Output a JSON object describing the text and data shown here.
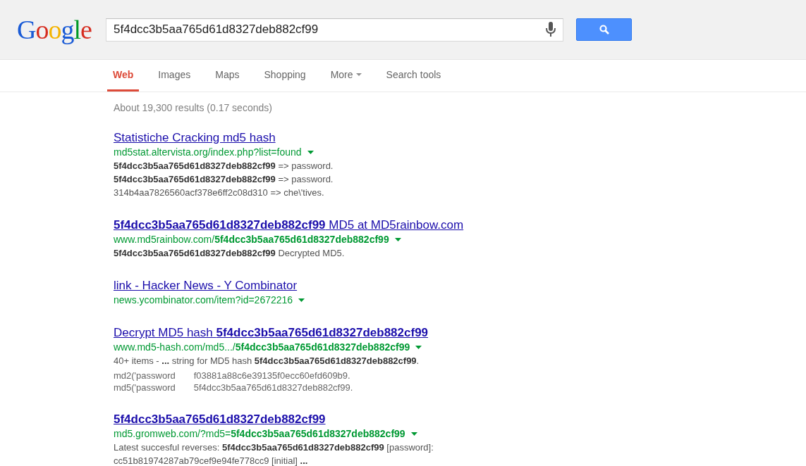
{
  "logo": "Google",
  "search": {
    "value": "5f4dcc3b5aa765d61d8327deb882cf99"
  },
  "tabs": [
    {
      "label": "Web",
      "selected": true,
      "kind": "tab"
    },
    {
      "label": "Images",
      "selected": false,
      "kind": "tab"
    },
    {
      "label": "Maps",
      "selected": false,
      "kind": "tab"
    },
    {
      "label": "Shopping",
      "selected": false,
      "kind": "tab"
    },
    {
      "label": "More",
      "selected": false,
      "kind": "menu"
    },
    {
      "label": "Search tools",
      "selected": false,
      "kind": "tab"
    }
  ],
  "result_stats": "About 19,300 results (0.17 seconds)",
  "results": [
    {
      "title": "Statistiche Cracking md5 hash",
      "url": "md5stat.altervista.org/index.php?list=found",
      "snippet": [
        "**5f4dcc3b5aa765d61d8327deb882cf99** => password.",
        "**5f4dcc3b5aa765d61d8327deb882cf99** => password.",
        "314b4aa7826560acf378e6ff2c08d310 => che\\'tives."
      ]
    },
    {
      "title": "**5f4dcc3b5aa765d61d8327deb882cf99** MD5 at MD5rainbow.com",
      "url": "www.md5rainbow.com/**5f4dcc3b5aa765d61d8327deb882cf99**",
      "snippet": [
        "**5f4dcc3b5aa765d61d8327deb882cf99** Decrypted MD5."
      ]
    },
    {
      "title": "link - Hacker News - Y Combinator",
      "url": "news.ycombinator.com/item?id=2672216"
    },
    {
      "title": "Decrypt MD5 hash **5f4dcc3b5aa765d61d8327deb882cf99**",
      "url": "www.md5-hash.com/md5.../**5f4dcc3b5aa765d61d8327deb882cf99**",
      "snippet": [
        "40+ items - **...** string for MD5 hash **5f4dcc3b5aa765d61d8327deb882cf99**."
      ],
      "table": [
        [
          "md2('password",
          "f03881a88c6e39135f0ecc60efd609b9."
        ],
        [
          "md5('password",
          "5f4dcc3b5aa765d61d8327deb882cf99."
        ]
      ]
    },
    {
      "title": "5f4dcc3b5aa765d61d8327deb882cf99",
      "title_bold": true,
      "url": "md5.gromweb.com/?md5=**5f4dcc3b5aa765d61d8327deb882cf99**",
      "snippet": [
        "Latest succesful reverses: **5f4dcc3b5aa765d61d8327deb882cf99** [password]:",
        "cc51b81974287ab79cef9e94fe778cc9 [initial] **...**"
      ]
    }
  ]
}
